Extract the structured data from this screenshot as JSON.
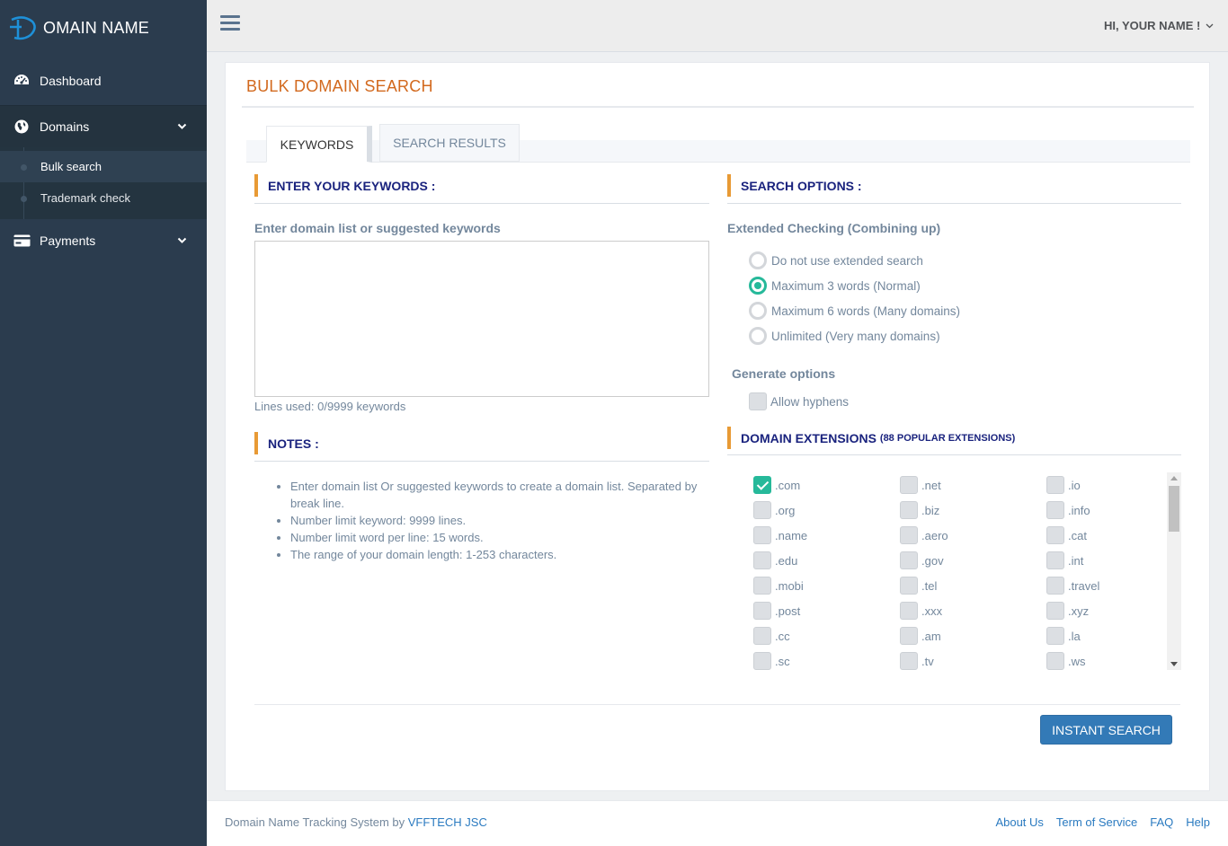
{
  "brand": {
    "name": "OMAIN NAME"
  },
  "sidebar": {
    "items": [
      {
        "label": "Dashboard",
        "icon": "dashboard-icon"
      },
      {
        "label": "Domains",
        "icon": "globe-icon",
        "expanded": true,
        "children": [
          {
            "label": "Bulk search",
            "active": true
          },
          {
            "label": "Trademark check"
          }
        ]
      },
      {
        "label": "Payments",
        "icon": "credit-card-icon"
      }
    ]
  },
  "topbar": {
    "user_greeting": "HI, YOUR NAME !"
  },
  "page": {
    "title": "BULK DOMAIN SEARCH",
    "tabs": [
      {
        "label": "KEYWORDS",
        "active": true
      },
      {
        "label": "SEARCH RESULTS"
      }
    ]
  },
  "keywords": {
    "heading": "ENTER YOUR KEYWORDS :",
    "label": "Enter domain list or suggested keywords",
    "value": "",
    "lines_used": "Lines used: 0/9999 keywords"
  },
  "notes": {
    "heading": "NOTES :",
    "items": [
      "Enter domain list Or suggested keywords to create a domain list. Separated by break line.",
      "Number limit keyword: 9999 lines.",
      "Number limit word per line: 15 words.",
      "The range of your domain length: 1-253 characters."
    ]
  },
  "search_options": {
    "heading": "SEARCH OPTIONS :",
    "extended_label": "Extended Checking (Combining up)",
    "extended_options": [
      {
        "label": "Do not use extended search",
        "selected": false
      },
      {
        "label": "Maximum 3 words (Normal)",
        "selected": true
      },
      {
        "label": "Maximum 6 words (Many domains)",
        "selected": false
      },
      {
        "label": "Unlimited (Very many domains)",
        "selected": false
      }
    ],
    "generate_label": "Generate options",
    "allow_hyphens": {
      "label": "Allow hyphens",
      "checked": false
    }
  },
  "extensions": {
    "heading": "DOMAIN EXTENSIONS",
    "subheading": "(88 POPULAR EXTENSIONS)",
    "items": [
      {
        "label": ".com",
        "checked": true
      },
      {
        "label": ".net",
        "checked": false
      },
      {
        "label": ".io",
        "checked": false
      },
      {
        "label": ".org",
        "checked": false
      },
      {
        "label": ".biz",
        "checked": false
      },
      {
        "label": ".info",
        "checked": false
      },
      {
        "label": ".name",
        "checked": false
      },
      {
        "label": ".aero",
        "checked": false
      },
      {
        "label": ".cat",
        "checked": false
      },
      {
        "label": ".edu",
        "checked": false
      },
      {
        "label": ".gov",
        "checked": false
      },
      {
        "label": ".int",
        "checked": false
      },
      {
        "label": ".mobi",
        "checked": false
      },
      {
        "label": ".tel",
        "checked": false
      },
      {
        "label": ".travel",
        "checked": false
      },
      {
        "label": ".post",
        "checked": false
      },
      {
        "label": ".xxx",
        "checked": false
      },
      {
        "label": ".xyz",
        "checked": false
      },
      {
        "label": ".cc",
        "checked": false
      },
      {
        "label": ".am",
        "checked": false
      },
      {
        "label": ".la",
        "checked": false
      },
      {
        "label": ".sc",
        "checked": false
      },
      {
        "label": ".tv",
        "checked": false
      },
      {
        "label": ".ws",
        "checked": false
      }
    ]
  },
  "actions": {
    "search_label": "INSTANT SEARCH"
  },
  "footer": {
    "prefix": "Domain Name Tracking System by",
    "company": "VFFTECH JSC",
    "links": [
      "About Us",
      "Term of Service",
      "FAQ",
      "Help"
    ]
  },
  "colors": {
    "sidebar": "#2b3c4e",
    "accent": "#26b99a",
    "title": "#d2691e",
    "section_bar": "#e89a35",
    "button": "#337ab7"
  }
}
